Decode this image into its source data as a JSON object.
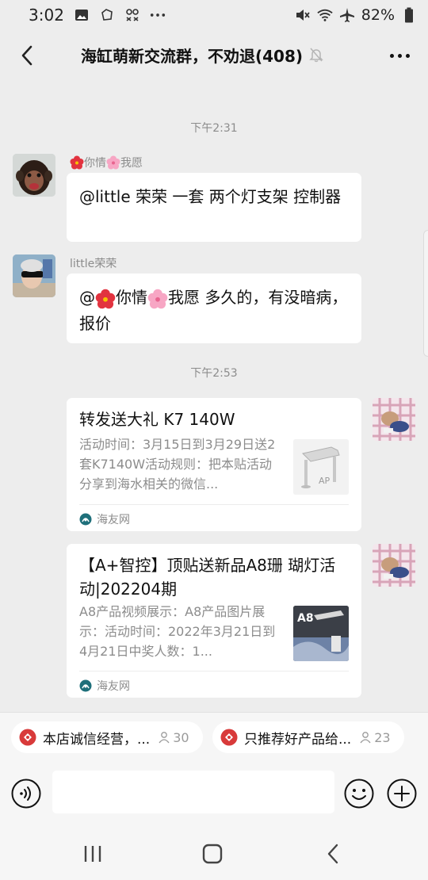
{
  "status_bar": {
    "time": "3:02",
    "battery": "82%"
  },
  "header": {
    "title": "海缸萌新交流群，不劝退(408)"
  },
  "messages": [
    {
      "timestamp": "下午2:31"
    },
    {
      "sender": "你情",
      "sender_part2": "我愿",
      "text": "@little 荣荣  一套  两个灯支架  控制器"
    },
    {
      "sender": "little荣荣",
      "text_part1": "@",
      "text_part2": "你情",
      "text_part3": "我愿   多久的，有没暗病，报价"
    },
    {
      "timestamp": "下午2:53"
    },
    {
      "card_title": "转发送大礼  K7 140W",
      "card_desc": "活动时间：3月15日到3月29日送2套K7140W活动规则：把本贴活动分享到海水相关的微信...",
      "card_source": "海友网",
      "thumb_label": "AP"
    },
    {
      "card_title": "【A+智控】顶贴送新品A8珊 瑚灯活动|202204期",
      "card_desc": "A8产品视频展示：A8产品图片展示：活动时间：2022年3月21日到4月21日中奖人数：1...",
      "card_source": "海友网",
      "thumb_label": "A8"
    }
  ],
  "chips": [
    {
      "label": "本店诚信经营，...",
      "count": "30"
    },
    {
      "label": "只推荐好产品给...",
      "count": "23"
    }
  ],
  "input": {
    "placeholder": ""
  }
}
